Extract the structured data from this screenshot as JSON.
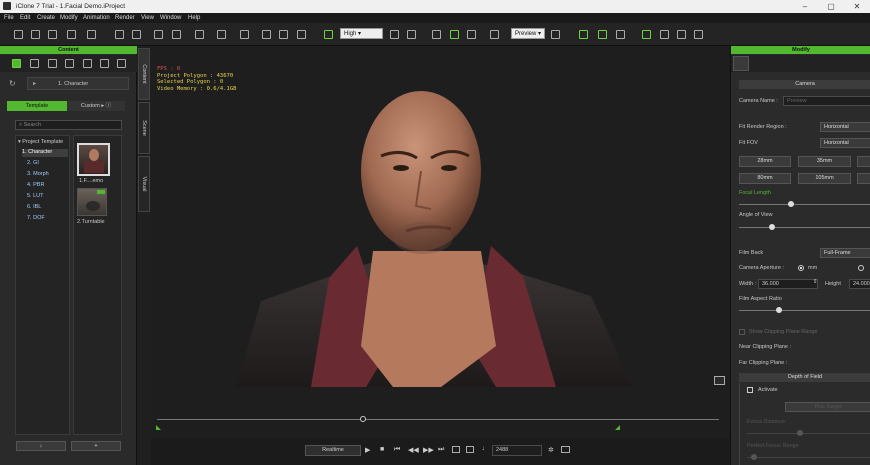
{
  "window": {
    "title": "iClone 7 Trial - 1.Facial Demo.iProject",
    "minimize_icon": "minimize-icon",
    "maximize_icon": "maximize-icon",
    "close_icon": "close-icon"
  },
  "menu": [
    "File",
    "Edit",
    "Create",
    "Modify",
    "Animation",
    "Render",
    "View",
    "Window",
    "Help"
  ],
  "toolbar": {
    "quality_value": "High",
    "preview_value": "Preview"
  },
  "content_panel": {
    "title": "Content",
    "breadcrumb": "1. Character",
    "tabs": {
      "template": "Template",
      "custom": "Custom"
    },
    "search_placeholder": "Search",
    "tree": [
      {
        "label": "Project Template",
        "selected": false,
        "root": true
      },
      {
        "label": "1. Character",
        "selected": true
      },
      {
        "label": "2. GI",
        "selected": false
      },
      {
        "label": "3. Morph",
        "selected": false
      },
      {
        "label": "4. PBR",
        "selected": false
      },
      {
        "label": "5. LUT",
        "selected": false
      },
      {
        "label": "6. IBL",
        "selected": false
      },
      {
        "label": "7. DOF",
        "selected": false
      }
    ],
    "thumbnails": [
      {
        "label": "1.F....emo"
      },
      {
        "label": "2.Turntable"
      }
    ],
    "bottom_buttons": {
      "down_icon": "download-icon",
      "add_icon": "plus-icon",
      "add_label": "+"
    }
  },
  "side_tabs": [
    "Content",
    "Scene",
    "Visual"
  ],
  "viewport": {
    "stats": [
      "FPS : 0",
      "Project Polygon : 43670",
      "Selected Polygon : 0",
      "Video Memory : 0.6/4.1GB"
    ]
  },
  "modify_panel": {
    "title": "Modify",
    "section_camera": "Camera",
    "camera_name_label": "Camera Name :",
    "camera_name_placeholder": "Preview",
    "fit_render_region_label": "Fit Render Region :",
    "fit_render_region_value": "Horizontal",
    "fit_fov_label": "Fit FOV",
    "fit_fov_value": "Horizontal",
    "lens_buttons": [
      "28mm",
      "35mm",
      "80mm",
      "105mm"
    ],
    "focal_length_label": "Focal Length",
    "angle_of_view_label": "Angle of View",
    "film_back_label": "Film Back",
    "film_back_value": "Full-Frame",
    "camera_aperture_label": "Camera Aperture :",
    "aperture_unit_mm": "mm",
    "width_label": "Width :",
    "width_value": "36.000",
    "height_label": "Height",
    "height_value": "24.000",
    "film_aspect_label": "Film Aspect Ratio",
    "show_clipping_label": "Show Clipping Plane Range",
    "near_clip_label": "Near Clipping Plane :",
    "far_clip_label": "Far Clipping Plane :",
    "section_dof": "Depth of Field",
    "activate_label": "Activate",
    "pick_target_label": "Pick Target",
    "focus_distance_label": "Focus Distance",
    "perfect_focus_label": "Perfect Focus Range"
  },
  "timeline": {
    "mode": "Realtime",
    "frame": "2488"
  },
  "colors": {
    "accent_green": "#52b82f",
    "viewport_bg": "#1e1e1e",
    "panel_bg": "#2a2a2a",
    "stats_text": "#e6d34a"
  }
}
